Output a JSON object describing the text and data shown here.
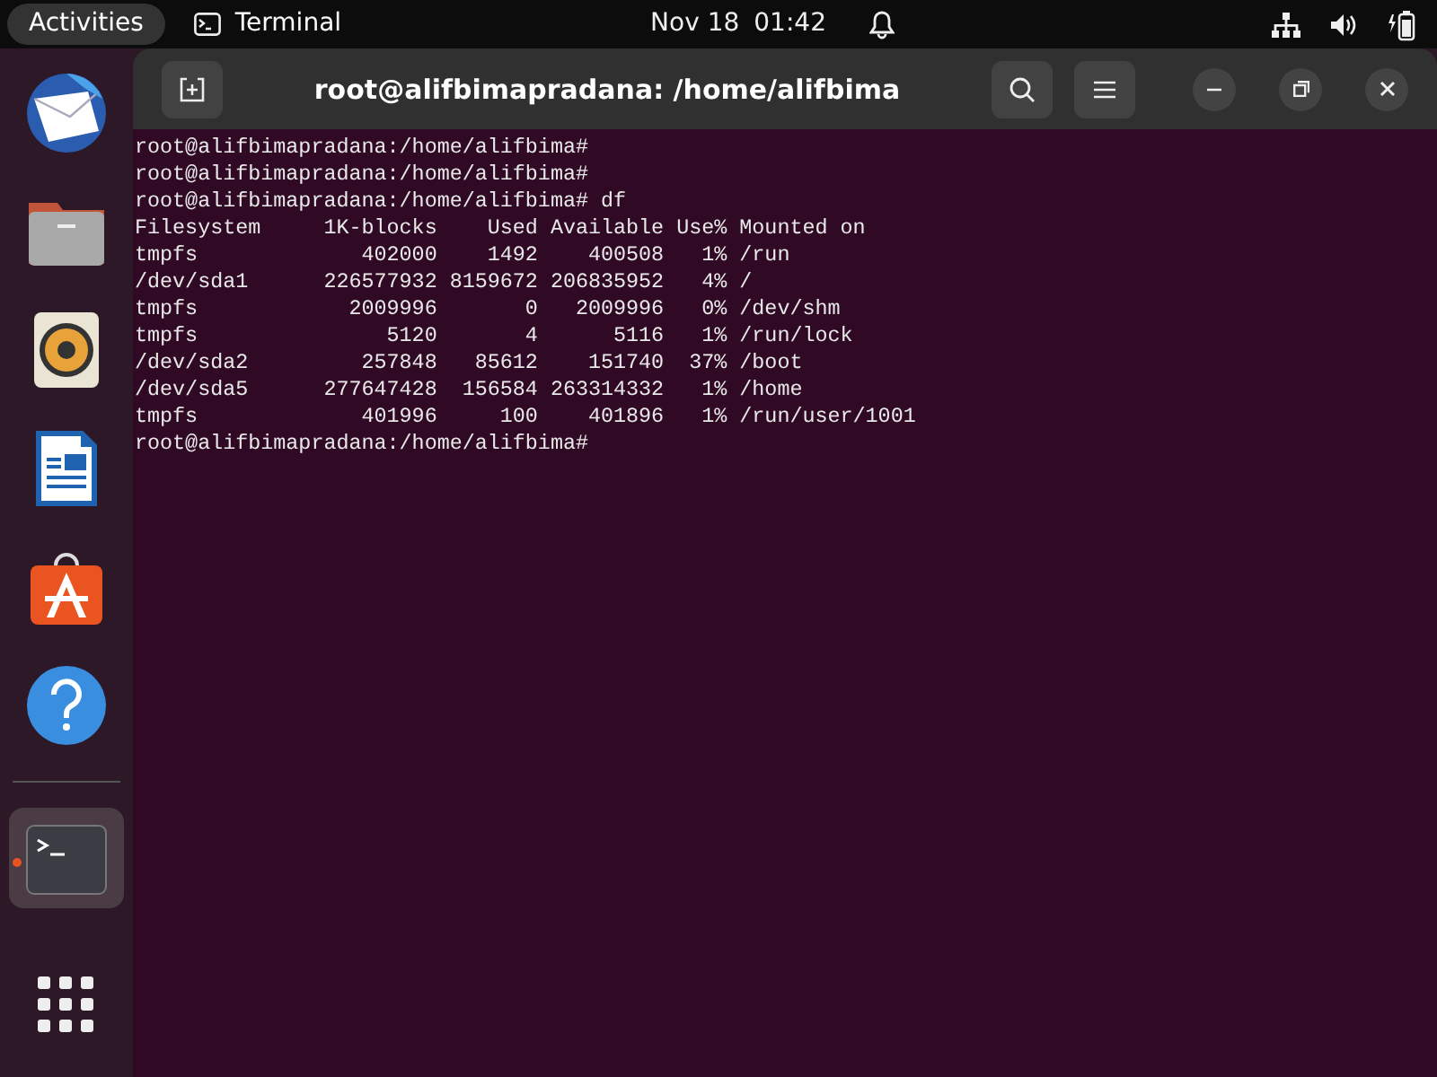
{
  "top_bar": {
    "activities": "Activities",
    "app_menu": "Terminal",
    "date": "Nov 18",
    "time": "01:42"
  },
  "dock": {
    "items": [
      {
        "kind": "mail",
        "running": false,
        "selected": false
      },
      {
        "kind": "files",
        "running": false,
        "selected": false
      },
      {
        "kind": "music",
        "running": false,
        "selected": false
      },
      {
        "kind": "writer",
        "running": false,
        "selected": false
      },
      {
        "kind": "software",
        "running": false,
        "selected": false
      },
      {
        "kind": "help",
        "running": false,
        "selected": false
      },
      {
        "kind": "terminal",
        "running": true,
        "selected": true
      }
    ]
  },
  "terminal": {
    "title": "root@alifbimapradana: /home/alifbima",
    "lines": [
      "root@alifbimapradana:/home/alifbima#",
      "root@alifbimapradana:/home/alifbima#",
      "root@alifbimapradana:/home/alifbima# df",
      "Filesystem     1K-blocks    Used Available Use% Mounted on",
      "tmpfs             402000    1492    400508   1% /run",
      "/dev/sda1      226577932 8159672 206835952   4% /",
      "tmpfs            2009996       0   2009996   0% /dev/shm",
      "tmpfs               5120       4      5116   1% /run/lock",
      "/dev/sda2         257848   85612    151740  37% /boot",
      "/dev/sda5      277647428  156584 263314332   1% /home",
      "tmpfs             401996     100    401896   1% /run/user/1001",
      "root@alifbimapradana:/home/alifbima#"
    ]
  }
}
